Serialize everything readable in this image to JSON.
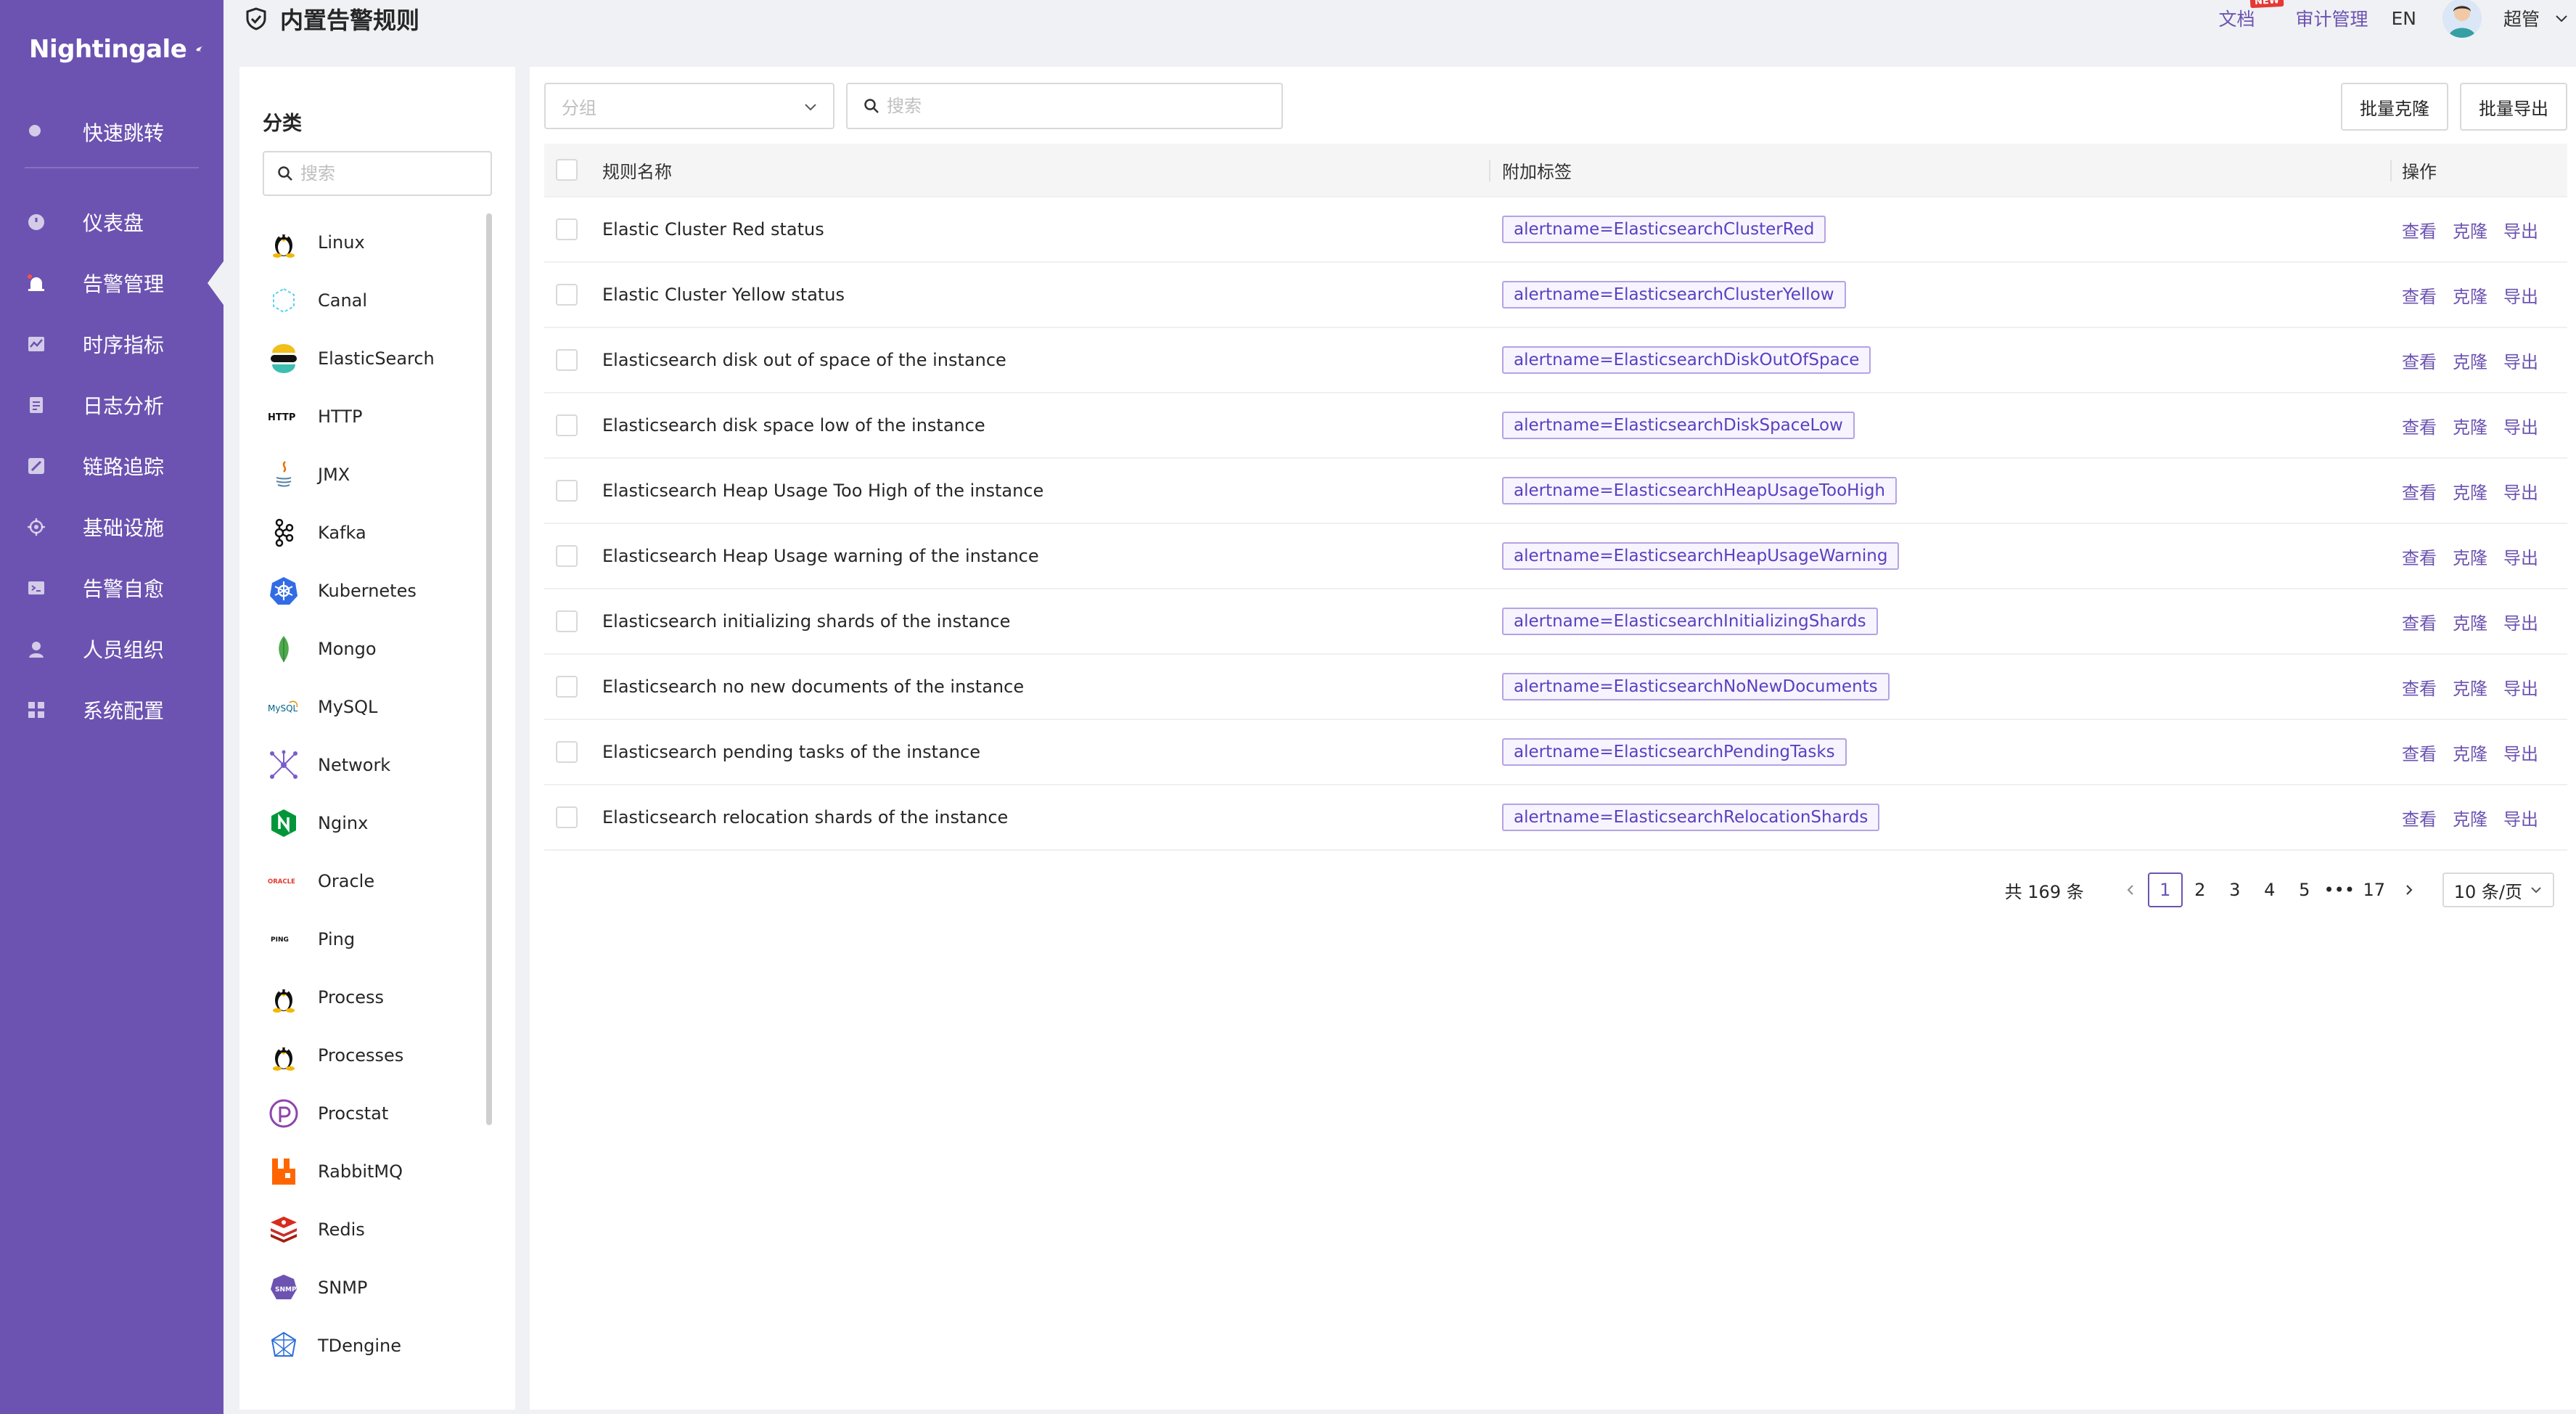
{
  "app": {
    "logo_text": "Nightingale",
    "brand_color": "#6c53b1",
    "nav": [
      {
        "label": "快速跳转",
        "icon": "search-icon"
      },
      {
        "label": "仪表盘",
        "icon": "dashboard-icon"
      },
      {
        "label": "告警管理",
        "icon": "alarm-icon",
        "active": true
      },
      {
        "label": "时序指标",
        "icon": "line-chart-icon"
      },
      {
        "label": "日志分析",
        "icon": "log-icon"
      },
      {
        "label": "链路追踪",
        "icon": "trace-icon"
      },
      {
        "label": "基础设施",
        "icon": "infra-icon"
      },
      {
        "label": "告警自愈",
        "icon": "terminal-icon"
      },
      {
        "label": "人员组织",
        "icon": "user-icon"
      },
      {
        "label": "系统配置",
        "icon": "settings-grid-icon"
      }
    ]
  },
  "header": {
    "title": "内置告警规则",
    "docs": "文档",
    "new_badge": "NEW",
    "audit": "审计管理",
    "lang": "EN",
    "username": "超管"
  },
  "categories": {
    "title": "分类",
    "search_placeholder": "搜索",
    "items": [
      {
        "label": "Linux",
        "icon": "linux-icon"
      },
      {
        "label": "Canal",
        "icon": "canal-icon"
      },
      {
        "label": "ElasticSearch",
        "icon": "elasticsearch-icon"
      },
      {
        "label": "HTTP",
        "icon": "http-icon",
        "icon_text": "HTTP"
      },
      {
        "label": "JMX",
        "icon": "java-icon"
      },
      {
        "label": "Kafka",
        "icon": "kafka-icon"
      },
      {
        "label": "Kubernetes",
        "icon": "kubernetes-icon"
      },
      {
        "label": "Mongo",
        "icon": "mongo-icon"
      },
      {
        "label": "MySQL",
        "icon": "mysql-icon",
        "icon_text": "MySQL"
      },
      {
        "label": "Network",
        "icon": "network-icon"
      },
      {
        "label": "Nginx",
        "icon": "nginx-icon"
      },
      {
        "label": "Oracle",
        "icon": "oracle-icon",
        "icon_text": "ORACLE"
      },
      {
        "label": "Ping",
        "icon": "ping-icon",
        "icon_text": "PING"
      },
      {
        "label": "Process",
        "icon": "linux-icon"
      },
      {
        "label": "Processes",
        "icon": "linux-icon"
      },
      {
        "label": "Procstat",
        "icon": "procstat-icon"
      },
      {
        "label": "RabbitMQ",
        "icon": "rabbitmq-icon"
      },
      {
        "label": "Redis",
        "icon": "redis-icon"
      },
      {
        "label": "SNMP",
        "icon": "snmp-icon"
      },
      {
        "label": "TDengine",
        "icon": "tdengine-icon"
      }
    ]
  },
  "toolbar": {
    "group_placeholder": "分组",
    "search_placeholder": "搜索",
    "batch_clone": "批量克隆",
    "batch_export": "批量导出"
  },
  "table": {
    "columns": {
      "name": "规则名称",
      "tags": "附加标签",
      "ops": "操作"
    },
    "ops": {
      "view": "查看",
      "clone": "克隆",
      "export": "导出"
    },
    "rows": [
      {
        "name": "Elastic Cluster Red status",
        "tag": "alertname=ElasticsearchClusterRed"
      },
      {
        "name": "Elastic Cluster Yellow status",
        "tag": "alertname=ElasticsearchClusterYellow"
      },
      {
        "name": "Elasticsearch disk out of space of the instance",
        "tag": "alertname=ElasticsearchDiskOutOfSpace"
      },
      {
        "name": "Elasticsearch disk space low of the instance",
        "tag": "alertname=ElasticsearchDiskSpaceLow"
      },
      {
        "name": "Elasticsearch Heap Usage Too High of the instance",
        "tag": "alertname=ElasticsearchHeapUsageTooHigh"
      },
      {
        "name": "Elasticsearch Heap Usage warning of the instance",
        "tag": "alertname=ElasticsearchHeapUsageWarning"
      },
      {
        "name": "Elasticsearch initializing shards of the instance",
        "tag": "alertname=ElasticsearchInitializingShards"
      },
      {
        "name": "Elasticsearch no new documents of the instance",
        "tag": "alertname=ElasticsearchNoNewDocuments"
      },
      {
        "name": "Elasticsearch pending tasks of the instance",
        "tag": "alertname=ElasticsearchPendingTasks"
      },
      {
        "name": "Elasticsearch relocation shards of the instance",
        "tag": "alertname=ElasticsearchRelocationShards"
      }
    ]
  },
  "pagination": {
    "total": "共 169 条",
    "pages": [
      "1",
      "2",
      "3",
      "4",
      "5",
      "•••",
      "17"
    ],
    "current": "1",
    "page_size": "10 条/页"
  }
}
